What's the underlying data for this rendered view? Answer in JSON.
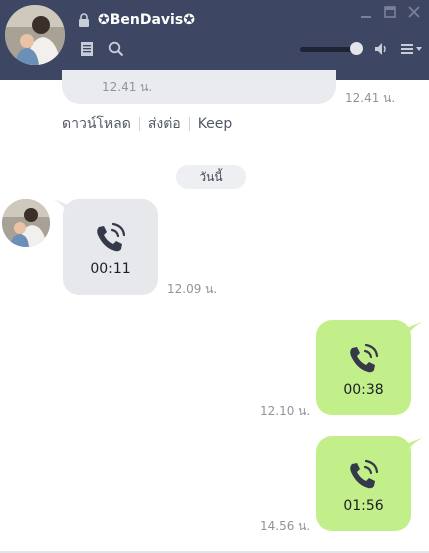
{
  "header": {
    "contact_name": "✪BenDavis✪"
  },
  "previous_message": {
    "bubble_time": "12.41 น.",
    "time": "12.41 น.",
    "actions": [
      "ดาวน์โหลด",
      "ส่งต่อ",
      "Keep"
    ]
  },
  "date_separator": "วันนี้",
  "messages": [
    {
      "direction": "incoming",
      "duration": "00:11",
      "time": "12.09 น."
    },
    {
      "direction": "outgoing",
      "duration": "00:38",
      "time": "12.10 น."
    },
    {
      "direction": "outgoing",
      "duration": "01:56",
      "time": "14.56 น."
    }
  ],
  "colors": {
    "header_bg": "#3d4663",
    "outgoing_bubble": "#c3ef8a",
    "incoming_bubble": "#e6e8ec"
  }
}
